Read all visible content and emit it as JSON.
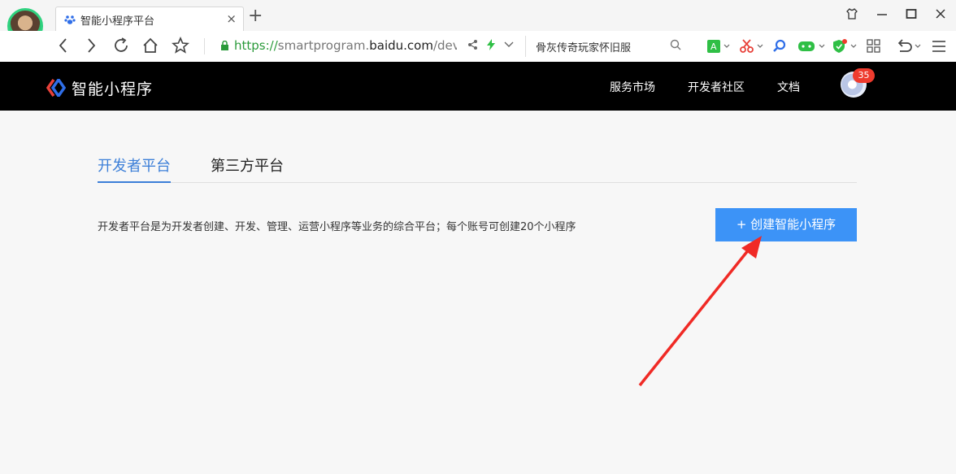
{
  "browser": {
    "tab_title": "智能小程序平台",
    "tab_close": "×",
    "new_tab": "+",
    "url_protocol": "https://",
    "url_sub": "smartprogram.",
    "url_domain": "baidu.com",
    "url_path": "/develop",
    "search_text": "骨灰传奇玩家怀旧服"
  },
  "site": {
    "brand": "智能小程序",
    "nav": [
      "服务市场",
      "开发者社区",
      "文档"
    ],
    "badge_count": "35"
  },
  "page": {
    "tabs": [
      {
        "label": "开发者平台",
        "active": true
      },
      {
        "label": "第三方平台",
        "active": false
      }
    ],
    "description": "开发者平台是为开发者创建、开发、管理、运营小程序等业务的综合平台；每个账号可创建20个小程序",
    "create_button": "+ 创建智能小程序"
  },
  "colors": {
    "accent": "#3c7fd8",
    "button": "#3c93f7",
    "header_bg": "#000000",
    "badge": "#ee3b2e",
    "annotation_arrow": "#f02a25"
  }
}
